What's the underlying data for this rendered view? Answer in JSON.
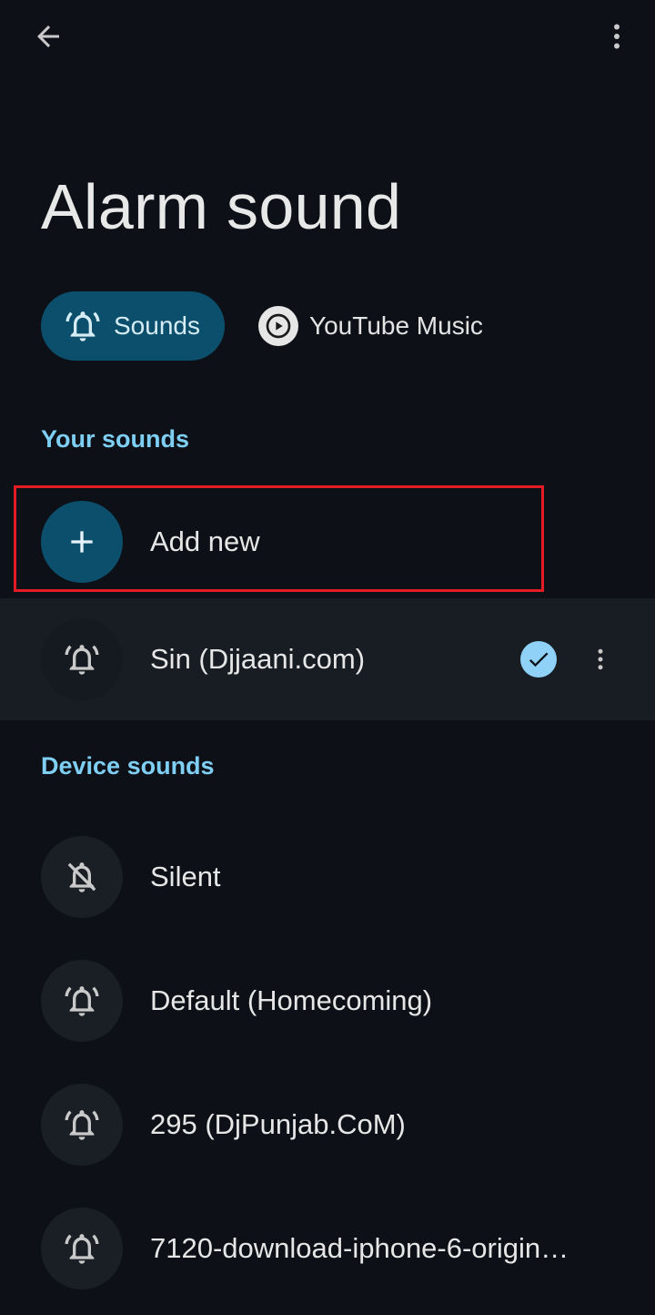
{
  "header": {
    "back_icon": "arrow-back-icon",
    "more_icon": "more-vert-icon"
  },
  "title": "Alarm sound",
  "tabs": [
    {
      "label": "Sounds",
      "icon": "alarm-bell-icon",
      "selected": true
    },
    {
      "label": "YouTube Music",
      "icon": "youtube-music-icon",
      "selected": false
    }
  ],
  "your_sounds": {
    "header": "Your sounds",
    "add_new_label": "Add new",
    "items": [
      {
        "label": "Sin (Djjaani.com)",
        "selected": true
      }
    ]
  },
  "device_sounds": {
    "header": "Device sounds",
    "items": [
      {
        "label": "Silent",
        "icon": "alarm-off-icon"
      },
      {
        "label": "Default (Homecoming)",
        "icon": "alarm-bell-icon"
      },
      {
        "label": "295 (DjPunjab.CoM)",
        "icon": "alarm-bell-icon"
      },
      {
        "label": "7120-download-iphone-6-origin…",
        "icon": "alarm-bell-icon"
      }
    ]
  },
  "colors": {
    "background": "#0d1117",
    "accent": "#0b4f6c",
    "section_header": "#7fcff5",
    "check": "#8fd1f7",
    "highlight": "#e21b24"
  }
}
